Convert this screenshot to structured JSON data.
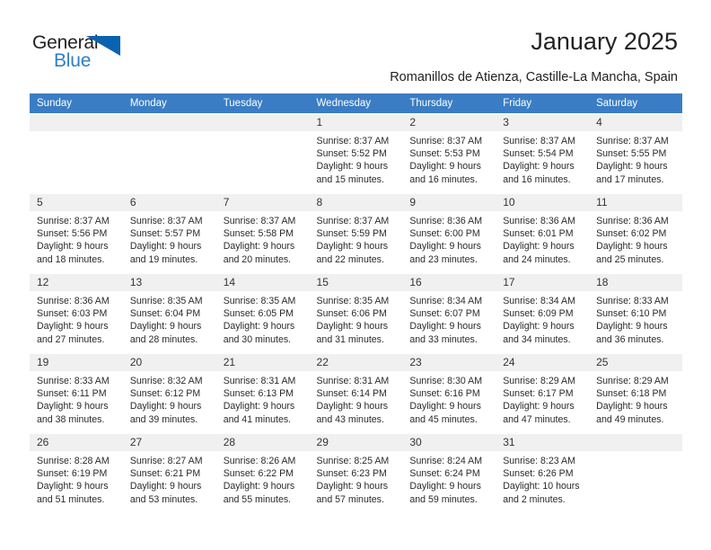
{
  "brand": {
    "name_part1": "General",
    "name_part2": "Blue",
    "triangle_color": "#0b63b0",
    "blue_text_color": "#2f7fc1"
  },
  "header": {
    "title": "January 2025",
    "subtitle": "Romanillos de Atienza, Castille-La Mancha, Spain"
  },
  "theme": {
    "header_blue": "#3b7dc4",
    "daynum_band": "#f0f0f0"
  },
  "weekday_headers": [
    "Sunday",
    "Monday",
    "Tuesday",
    "Wednesday",
    "Thursday",
    "Friday",
    "Saturday"
  ],
  "weeks": [
    [
      {
        "day": "",
        "sunrise": "",
        "sunset": "",
        "daylight1": "",
        "daylight2": ""
      },
      {
        "day": "",
        "sunrise": "",
        "sunset": "",
        "daylight1": "",
        "daylight2": ""
      },
      {
        "day": "",
        "sunrise": "",
        "sunset": "",
        "daylight1": "",
        "daylight2": ""
      },
      {
        "day": "1",
        "sunrise": "Sunrise: 8:37 AM",
        "sunset": "Sunset: 5:52 PM",
        "daylight1": "Daylight: 9 hours",
        "daylight2": "and 15 minutes."
      },
      {
        "day": "2",
        "sunrise": "Sunrise: 8:37 AM",
        "sunset": "Sunset: 5:53 PM",
        "daylight1": "Daylight: 9 hours",
        "daylight2": "and 16 minutes."
      },
      {
        "day": "3",
        "sunrise": "Sunrise: 8:37 AM",
        "sunset": "Sunset: 5:54 PM",
        "daylight1": "Daylight: 9 hours",
        "daylight2": "and 16 minutes."
      },
      {
        "day": "4",
        "sunrise": "Sunrise: 8:37 AM",
        "sunset": "Sunset: 5:55 PM",
        "daylight1": "Daylight: 9 hours",
        "daylight2": "and 17 minutes."
      }
    ],
    [
      {
        "day": "5",
        "sunrise": "Sunrise: 8:37 AM",
        "sunset": "Sunset: 5:56 PM",
        "daylight1": "Daylight: 9 hours",
        "daylight2": "and 18 minutes."
      },
      {
        "day": "6",
        "sunrise": "Sunrise: 8:37 AM",
        "sunset": "Sunset: 5:57 PM",
        "daylight1": "Daylight: 9 hours",
        "daylight2": "and 19 minutes."
      },
      {
        "day": "7",
        "sunrise": "Sunrise: 8:37 AM",
        "sunset": "Sunset: 5:58 PM",
        "daylight1": "Daylight: 9 hours",
        "daylight2": "and 20 minutes."
      },
      {
        "day": "8",
        "sunrise": "Sunrise: 8:37 AM",
        "sunset": "Sunset: 5:59 PM",
        "daylight1": "Daylight: 9 hours",
        "daylight2": "and 22 minutes."
      },
      {
        "day": "9",
        "sunrise": "Sunrise: 8:36 AM",
        "sunset": "Sunset: 6:00 PM",
        "daylight1": "Daylight: 9 hours",
        "daylight2": "and 23 minutes."
      },
      {
        "day": "10",
        "sunrise": "Sunrise: 8:36 AM",
        "sunset": "Sunset: 6:01 PM",
        "daylight1": "Daylight: 9 hours",
        "daylight2": "and 24 minutes."
      },
      {
        "day": "11",
        "sunrise": "Sunrise: 8:36 AM",
        "sunset": "Sunset: 6:02 PM",
        "daylight1": "Daylight: 9 hours",
        "daylight2": "and 25 minutes."
      }
    ],
    [
      {
        "day": "12",
        "sunrise": "Sunrise: 8:36 AM",
        "sunset": "Sunset: 6:03 PM",
        "daylight1": "Daylight: 9 hours",
        "daylight2": "and 27 minutes."
      },
      {
        "day": "13",
        "sunrise": "Sunrise: 8:35 AM",
        "sunset": "Sunset: 6:04 PM",
        "daylight1": "Daylight: 9 hours",
        "daylight2": "and 28 minutes."
      },
      {
        "day": "14",
        "sunrise": "Sunrise: 8:35 AM",
        "sunset": "Sunset: 6:05 PM",
        "daylight1": "Daylight: 9 hours",
        "daylight2": "and 30 minutes."
      },
      {
        "day": "15",
        "sunrise": "Sunrise: 8:35 AM",
        "sunset": "Sunset: 6:06 PM",
        "daylight1": "Daylight: 9 hours",
        "daylight2": "and 31 minutes."
      },
      {
        "day": "16",
        "sunrise": "Sunrise: 8:34 AM",
        "sunset": "Sunset: 6:07 PM",
        "daylight1": "Daylight: 9 hours",
        "daylight2": "and 33 minutes."
      },
      {
        "day": "17",
        "sunrise": "Sunrise: 8:34 AM",
        "sunset": "Sunset: 6:09 PM",
        "daylight1": "Daylight: 9 hours",
        "daylight2": "and 34 minutes."
      },
      {
        "day": "18",
        "sunrise": "Sunrise: 8:33 AM",
        "sunset": "Sunset: 6:10 PM",
        "daylight1": "Daylight: 9 hours",
        "daylight2": "and 36 minutes."
      }
    ],
    [
      {
        "day": "19",
        "sunrise": "Sunrise: 8:33 AM",
        "sunset": "Sunset: 6:11 PM",
        "daylight1": "Daylight: 9 hours",
        "daylight2": "and 38 minutes."
      },
      {
        "day": "20",
        "sunrise": "Sunrise: 8:32 AM",
        "sunset": "Sunset: 6:12 PM",
        "daylight1": "Daylight: 9 hours",
        "daylight2": "and 39 minutes."
      },
      {
        "day": "21",
        "sunrise": "Sunrise: 8:31 AM",
        "sunset": "Sunset: 6:13 PM",
        "daylight1": "Daylight: 9 hours",
        "daylight2": "and 41 minutes."
      },
      {
        "day": "22",
        "sunrise": "Sunrise: 8:31 AM",
        "sunset": "Sunset: 6:14 PM",
        "daylight1": "Daylight: 9 hours",
        "daylight2": "and 43 minutes."
      },
      {
        "day": "23",
        "sunrise": "Sunrise: 8:30 AM",
        "sunset": "Sunset: 6:16 PM",
        "daylight1": "Daylight: 9 hours",
        "daylight2": "and 45 minutes."
      },
      {
        "day": "24",
        "sunrise": "Sunrise: 8:29 AM",
        "sunset": "Sunset: 6:17 PM",
        "daylight1": "Daylight: 9 hours",
        "daylight2": "and 47 minutes."
      },
      {
        "day": "25",
        "sunrise": "Sunrise: 8:29 AM",
        "sunset": "Sunset: 6:18 PM",
        "daylight1": "Daylight: 9 hours",
        "daylight2": "and 49 minutes."
      }
    ],
    [
      {
        "day": "26",
        "sunrise": "Sunrise: 8:28 AM",
        "sunset": "Sunset: 6:19 PM",
        "daylight1": "Daylight: 9 hours",
        "daylight2": "and 51 minutes."
      },
      {
        "day": "27",
        "sunrise": "Sunrise: 8:27 AM",
        "sunset": "Sunset: 6:21 PM",
        "daylight1": "Daylight: 9 hours",
        "daylight2": "and 53 minutes."
      },
      {
        "day": "28",
        "sunrise": "Sunrise: 8:26 AM",
        "sunset": "Sunset: 6:22 PM",
        "daylight1": "Daylight: 9 hours",
        "daylight2": "and 55 minutes."
      },
      {
        "day": "29",
        "sunrise": "Sunrise: 8:25 AM",
        "sunset": "Sunset: 6:23 PM",
        "daylight1": "Daylight: 9 hours",
        "daylight2": "and 57 minutes."
      },
      {
        "day": "30",
        "sunrise": "Sunrise: 8:24 AM",
        "sunset": "Sunset: 6:24 PM",
        "daylight1": "Daylight: 9 hours",
        "daylight2": "and 59 minutes."
      },
      {
        "day": "31",
        "sunrise": "Sunrise: 8:23 AM",
        "sunset": "Sunset: 6:26 PM",
        "daylight1": "Daylight: 10 hours",
        "daylight2": "and 2 minutes."
      },
      {
        "day": "",
        "sunrise": "",
        "sunset": "",
        "daylight1": "",
        "daylight2": ""
      }
    ]
  ]
}
